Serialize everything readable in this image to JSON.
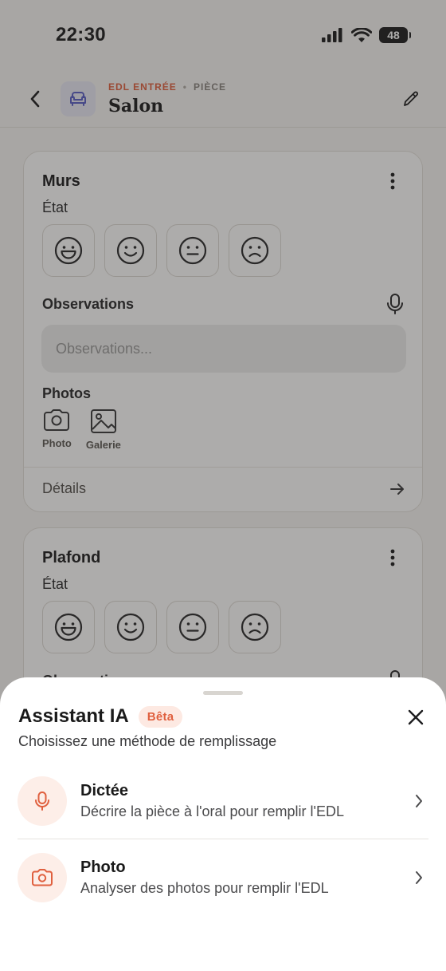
{
  "status_bar": {
    "time": "22:30",
    "battery": "48"
  },
  "header": {
    "kicker_primary": "EDL ENTRÉE",
    "kicker_separator": "•",
    "kicker_secondary": "PIÈCE",
    "title": "Salon"
  },
  "cards": [
    {
      "title": "Murs",
      "state_label": "État",
      "observations_label": "Observations",
      "observations_placeholder": "Observations...",
      "photos_label": "Photos",
      "photo_button": "Photo",
      "gallery_button": "Galerie",
      "details_label": "Détails"
    },
    {
      "title": "Plafond",
      "state_label": "État",
      "observations_label": "Observations"
    }
  ],
  "sheet": {
    "title": "Assistant IA",
    "badge": "Bêta",
    "subtitle": "Choisissez une méthode de remplissage",
    "options": [
      {
        "title": "Dictée",
        "description": "Décrire la pièce à l'oral pour remplir l'EDL",
        "icon": "microphone-icon"
      },
      {
        "title": "Photo",
        "description": "Analyser des photos pour remplir l'EDL",
        "icon": "camera-icon"
      }
    ]
  },
  "colors": {
    "accent": "#e0603f",
    "accent_soft": "#fdeee8",
    "room_icon_bg": "#e8e8f6",
    "room_icon": "#5b5fc7"
  }
}
